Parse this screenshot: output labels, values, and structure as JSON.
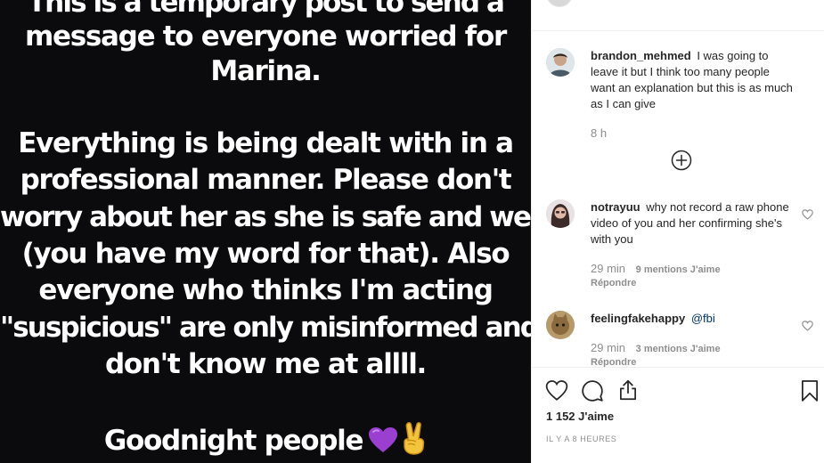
{
  "post": {
    "story_lines": [
      "This is a temporary post to send a",
      "message to everyone worried for",
      "Marina.",
      "Everything is being dealt with in a",
      "professional manner. Please don't",
      "worry about her as she is safe and well",
      "(you have my word for that). Also",
      "everyone who thinks I'm acting",
      "\"suspicious\" are only misinformed and",
      "don't know me at allll.",
      "Goodnight people"
    ],
    "emojis": [
      "purple-heart-icon",
      "victory-hand-icon"
    ],
    "background_color": "#0b0b0d",
    "text_color": "#ffffff"
  },
  "comments": [
    {
      "username": "brandon_mehmed",
      "text": "I was going to leave it but I think too many people want an explanation but this is as much as I can give",
      "time": "8 h"
    },
    {
      "username": "notrayuu",
      "text": "why not record a raw phone video of you and her confirming she's with you",
      "time": "29 min",
      "likes": "9 mentions J'aime",
      "reply": "Répondre"
    },
    {
      "username": "feelingfakehappy",
      "text": "@fbi",
      "time": "29 min",
      "likes": "3 mentions J'aime",
      "reply": "Répondre"
    }
  ],
  "actions": {
    "icons": [
      "heart-icon",
      "comment-icon",
      "share-icon",
      "bookmark-icon"
    ],
    "likes_total": "1 152 J'aime",
    "timestamp": "IL Y A 8 HEURES"
  },
  "colors": {
    "text": "#262626",
    "muted": "#8e8e8e",
    "mention": "#003569",
    "divider": "#efefef"
  }
}
